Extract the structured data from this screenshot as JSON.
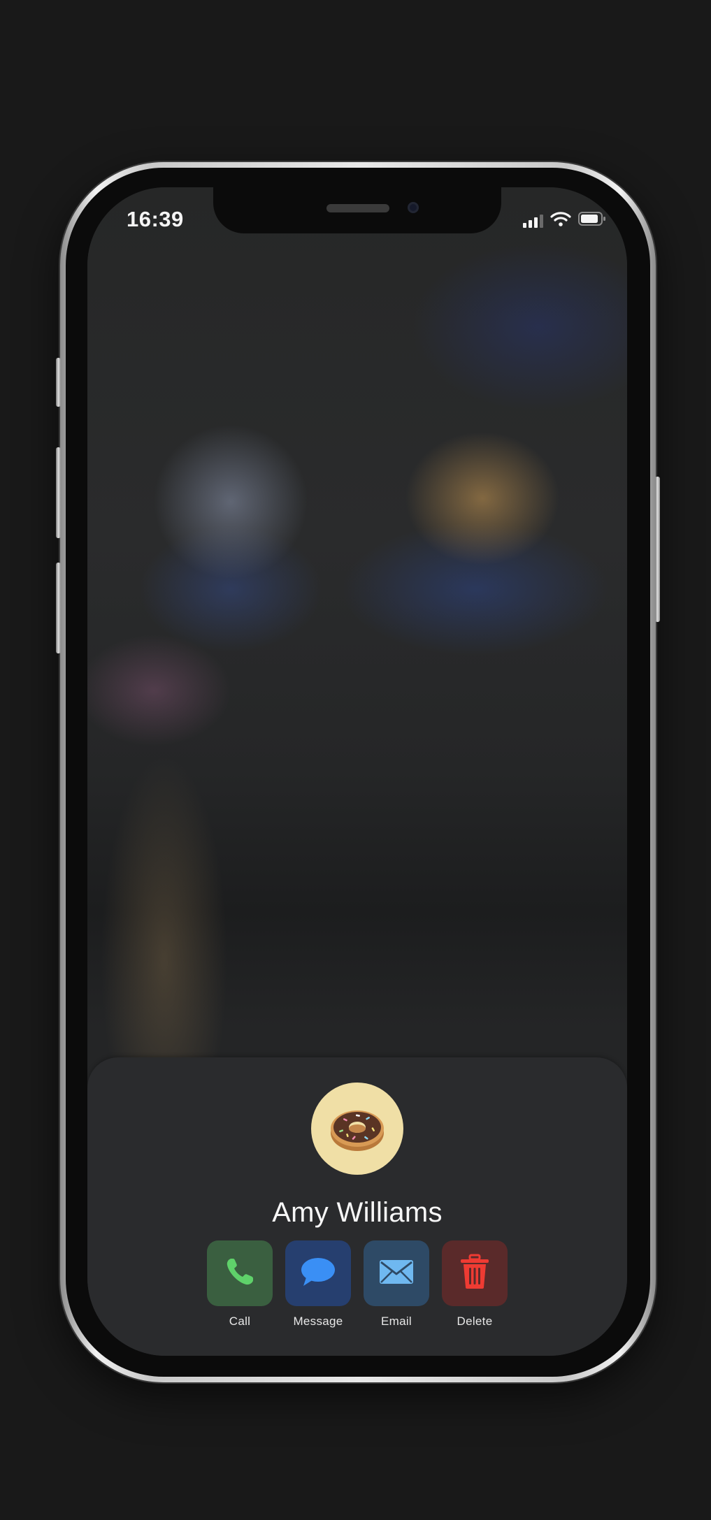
{
  "status_bar": {
    "time": "16:39",
    "signal_icon": "cellular-signal-icon",
    "wifi_icon": "wifi-icon",
    "battery_icon": "battery-icon"
  },
  "contact": {
    "name": "Amy Williams",
    "avatar_icon": "donut-icon",
    "avatar_color": "#f0dfa6"
  },
  "actions": [
    {
      "label": "Call",
      "icon": "phone-icon",
      "bg": "#3a5f40",
      "fg": "#5fd16a"
    },
    {
      "label": "Message",
      "icon": "message-bubble-icon",
      "bg": "#263f6f",
      "fg": "#3a8ff5"
    },
    {
      "label": "Email",
      "icon": "envelope-icon",
      "bg": "#2e4a66",
      "fg": "#6fb8f0"
    },
    {
      "label": "Delete",
      "icon": "trash-icon",
      "bg": "#5a2a2a",
      "fg": "#ef3b33"
    }
  ]
}
